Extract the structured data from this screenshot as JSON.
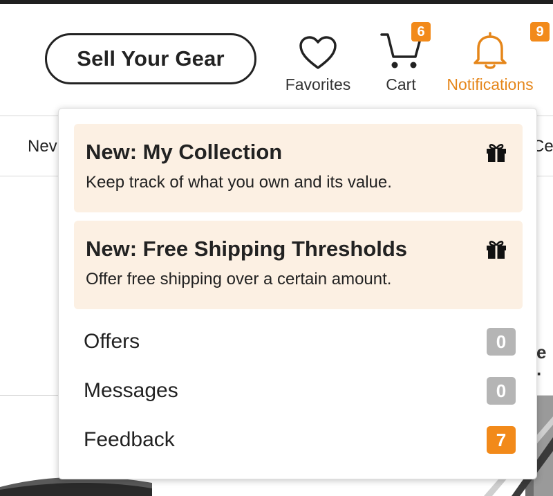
{
  "header": {
    "sell_button_label": "Sell Your Gear",
    "favorites": {
      "label": "Favorites",
      "icon": "heart-icon"
    },
    "cart": {
      "label": "Cart",
      "count": "6",
      "icon": "cart-icon"
    },
    "notifications": {
      "label": "Notifications",
      "count": "9",
      "icon": "bell-icon"
    }
  },
  "background": {
    "nav_fragment_left": "Nev",
    "nav_fragment_right": "Cer",
    "side_fragment_right": "e ·"
  },
  "notifications_menu": {
    "promos": [
      {
        "title": "New: My Collection",
        "description": "Keep track of what you own and its value.",
        "icon": "gift-icon"
      },
      {
        "title": "New: Free Shipping Thresholds",
        "description": "Offer free shipping over a certain amount.",
        "icon": "gift-icon"
      }
    ],
    "rows": [
      {
        "label": "Offers",
        "count": "0"
      },
      {
        "label": "Messages",
        "count": "0"
      },
      {
        "label": "Feedback",
        "count": "7"
      }
    ]
  },
  "colors": {
    "accent_orange": "#f28a1a",
    "notifications_text": "#e5861a",
    "promo_background": "#fcf0e3",
    "zero_badge_grey": "#b5b5b5"
  }
}
